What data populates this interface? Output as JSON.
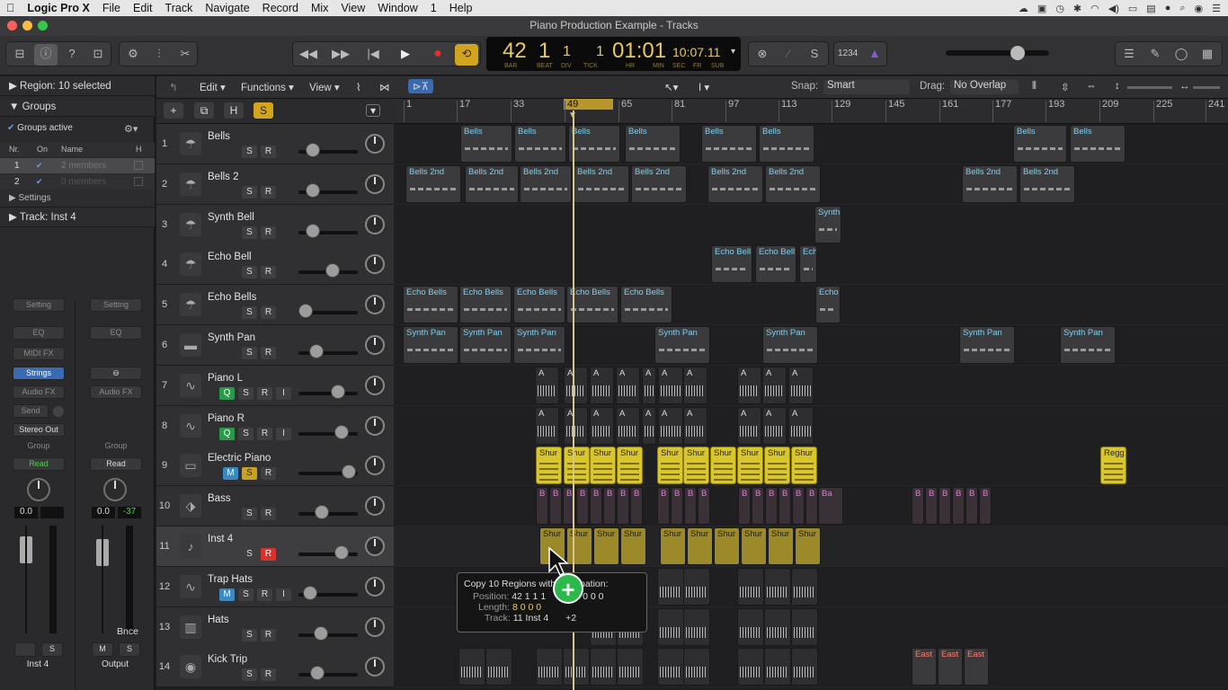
{
  "menubar": {
    "apple": "",
    "app": "Logic Pro X",
    "items": [
      "File",
      "Edit",
      "Track",
      "Navigate",
      "Record",
      "Mix",
      "View",
      "Window",
      "1",
      "Help"
    ]
  },
  "window": {
    "title": "Piano Production Example - Tracks"
  },
  "transport": {
    "bar": "42",
    "beat": "1",
    "div": "1",
    "tick": "1",
    "time": "01:01",
    "time_detail": "10:07.11",
    "bar_label": "BAR",
    "beat_label": "BEAT",
    "div_label": "DIV",
    "tick_label": "TICK",
    "hr_label": "HR",
    "min_label": "MIN",
    "sec_label": "SEC",
    "fr_label": "FR",
    "sub_label": "SUB",
    "count": "1234"
  },
  "inspector": {
    "region": "Region: 10 selected",
    "groups": "Groups",
    "groups_active": "Groups active",
    "cols": [
      "Nr.",
      "On",
      "Name",
      "H"
    ],
    "group_rows": [
      {
        "nr": "1",
        "name": "2 members"
      },
      {
        "nr": "2",
        "name": "0 members"
      }
    ],
    "settings": "Settings",
    "track": "Track: Inst 4"
  },
  "strips": [
    {
      "setting": "Setting",
      "eq": "EQ",
      "midi": "MIDI FX",
      "inst": "Strings",
      "audiofx": "Audio FX",
      "send": "Send",
      "out": "Stereo Out",
      "group": "Group",
      "auto": "Read",
      "val": "0.0",
      "name": "Inst 4",
      "mute": "",
      "solo": "S"
    },
    {
      "setting": "Setting",
      "eq": "EQ",
      "midi": "",
      "inst": "",
      "audiofx": "Audio FX",
      "send": "",
      "out": "",
      "group": "Group",
      "auto": "Read",
      "val": "0.0",
      "val2": "-37",
      "name": "Output",
      "bnce": "Bnce",
      "mute": "M",
      "solo": "S"
    }
  ],
  "tracks_toolbar": {
    "edit": "Edit",
    "functions": "Functions",
    "view": "View",
    "snap_label": "Snap:",
    "snap": "Smart",
    "drag_label": "Drag:",
    "drag": "No Overlap"
  },
  "ruler": [
    "1",
    "17",
    "33",
    "49",
    "65",
    "81",
    "97",
    "113",
    "129",
    "145",
    "161",
    "177",
    "193",
    "209",
    "225",
    "241"
  ],
  "tracks": [
    {
      "n": "1",
      "name": "Bells",
      "btns": [
        "S",
        "R"
      ]
    },
    {
      "n": "2",
      "name": "Bells 2",
      "btns": [
        "S",
        "R"
      ]
    },
    {
      "n": "3",
      "name": "Synth Bell",
      "btns": [
        "S",
        "R"
      ]
    },
    {
      "n": "4",
      "name": "Echo Bell",
      "btns": [
        "S",
        "R"
      ]
    },
    {
      "n": "5",
      "name": "Echo Bells",
      "btns": [
        "S",
        "R"
      ]
    },
    {
      "n": "6",
      "name": "Synth Pan",
      "btns": [
        "S",
        "R"
      ]
    },
    {
      "n": "7",
      "name": "Piano L",
      "btns": [
        "Q",
        "S",
        "R",
        "I"
      ]
    },
    {
      "n": "8",
      "name": "Piano R",
      "btns": [
        "Q",
        "S",
        "R",
        "I"
      ]
    },
    {
      "n": "9",
      "name": "Electric Piano",
      "btns": [
        "M",
        "S",
        "R"
      ]
    },
    {
      "n": "10",
      "name": "Bass",
      "btns": [
        "S",
        "R"
      ]
    },
    {
      "n": "11",
      "name": "Inst 4",
      "btns": [
        "S",
        "R"
      ]
    },
    {
      "n": "12",
      "name": "Trap Hats",
      "btns": [
        "M",
        "S",
        "R",
        "I"
      ]
    },
    {
      "n": "13",
      "name": "Hats",
      "btns": [
        "S",
        "R"
      ]
    },
    {
      "n": "14",
      "name": "Kick Trip",
      "btns": [
        "S",
        "R"
      ]
    }
  ],
  "regions": {
    "bells": "Bells",
    "bells2": "Bells 2nd",
    "synth": "Synth",
    "echobell": "Echo Bell",
    "ech": "Ech",
    "echobells": "Echo Bells",
    "echo": "Echo",
    "synthpan": "Synth Pan",
    "shur": "Shur",
    "regg": "Regg",
    "b": "B",
    "ba": "Ba",
    "east": "East",
    "a": "A"
  },
  "tooltip": {
    "line1": "Copy 10 Regions with Automation:",
    "pos_label": "Position:",
    "pos": "42 1 1 1",
    "pos2": "0 0 0",
    "len_label": "Length:",
    "len": "8 0 0 0",
    "track_label": "Track:",
    "track": "11  Inst 4",
    "extra": "+2"
  }
}
